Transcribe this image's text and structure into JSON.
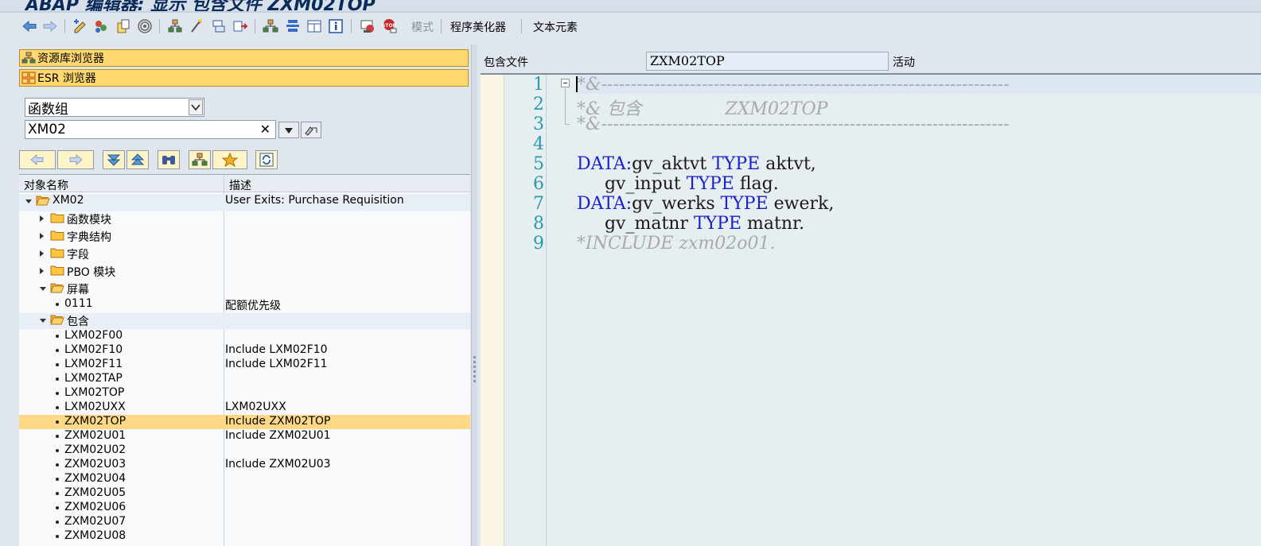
{
  "window": {
    "title": "ABAP 编辑器: 显示 包含文件 ZXM02TOP"
  },
  "toolbar": {
    "buttons": [
      {
        "name": "back-icon"
      },
      {
        "name": "forward-icon"
      },
      {
        "name": "display-change-icon"
      },
      {
        "name": "other-object-icon"
      },
      {
        "name": "check-icon"
      },
      {
        "name": "activate-icon"
      },
      {
        "name": "where-used-icon"
      },
      {
        "name": "object-list-icon"
      },
      {
        "name": "navigation-icon"
      },
      {
        "name": "layout-icon"
      },
      {
        "name": "hierarchy-icon"
      },
      {
        "name": "info-icon"
      },
      {
        "name": "breakpoint-icon"
      },
      {
        "name": "stop-breakpoint-icon"
      }
    ],
    "mode_label": "模式",
    "pretty_printer_label": "程序美化器",
    "text_elements_label": "文本元素"
  },
  "left_pane": {
    "repository_browser": "资源库浏览器",
    "esr_browser": "ESR 浏览器",
    "object_type": "函数组",
    "object_name": "XM02",
    "clear_symbol": "✕",
    "tree": {
      "col_name": "对象名称",
      "col_desc": "描述",
      "rows": [
        {
          "name": "XM02",
          "desc": "User Exits: Purchase Requisition"
        },
        {
          "name": "函数模块",
          "desc": ""
        },
        {
          "name": "字典结构",
          "desc": ""
        },
        {
          "name": "字段",
          "desc": ""
        },
        {
          "name": "PBO 模块",
          "desc": ""
        },
        {
          "name": "屏幕",
          "desc": ""
        },
        {
          "name": "0111",
          "desc": "配额优先级"
        },
        {
          "name": "包含",
          "desc": ""
        },
        {
          "name": "LXM02F00",
          "desc": ""
        },
        {
          "name": "LXM02F10",
          "desc": "Include LXM02F10"
        },
        {
          "name": "LXM02F11",
          "desc": "Include LXM02F11"
        },
        {
          "name": "LXM02TAP",
          "desc": ""
        },
        {
          "name": "LXM02TOP",
          "desc": ""
        },
        {
          "name": "LXM02UXX",
          "desc": "LXM02UXX"
        },
        {
          "name": "ZXM02TOP",
          "desc": "Include ZXM02TOP"
        },
        {
          "name": "ZXM02U01",
          "desc": "Include ZXM02U01"
        },
        {
          "name": "ZXM02U02",
          "desc": ""
        },
        {
          "name": "ZXM02U03",
          "desc": "Include ZXM02U03"
        },
        {
          "name": "ZXM02U04",
          "desc": ""
        },
        {
          "name": "ZXM02U05",
          "desc": ""
        },
        {
          "name": "ZXM02U06",
          "desc": ""
        },
        {
          "name": "ZXM02U07",
          "desc": ""
        },
        {
          "name": "ZXM02U08",
          "desc": ""
        }
      ]
    }
  },
  "editor": {
    "include_label": "包含文件",
    "include_name": "ZXM02TOP",
    "status": "活动",
    "line_numbers": [
      "1",
      "2",
      "3",
      "4",
      "5",
      "6",
      "7",
      "8",
      "9"
    ],
    "lines": {
      "l1": "*&---------------------------------------------------------------------",
      "l2": "*& 包含               ZXM02TOP",
      "l3": "*&---------------------------------------------------------------------",
      "l5_kw": "DATA",
      "l5_colon": ":",
      "l5_a": "gv_aktvt ",
      "l5_type": "TYPE",
      "l5_b": " aktvt,",
      "l6_a": "     gv_input ",
      "l6_type": "TYPE",
      "l6_b": " flag.",
      "l7_kw": "DATA",
      "l7_colon": ":",
      "l7_a": "gv_werks ",
      "l7_type": "TYPE",
      "l7_b": " ewerk,",
      "l8_a": "     gv_matnr ",
      "l8_type": "TYPE",
      "l8_b": " matnr.",
      "l9": "*INCLUDE zxm02o01."
    }
  },
  "colors": {
    "selection": "#ffd886",
    "keyword": "#1a22c8",
    "comment": "#a6aab0",
    "line_number": "#2a9aa7",
    "browser_bar": "#ffd86f"
  }
}
